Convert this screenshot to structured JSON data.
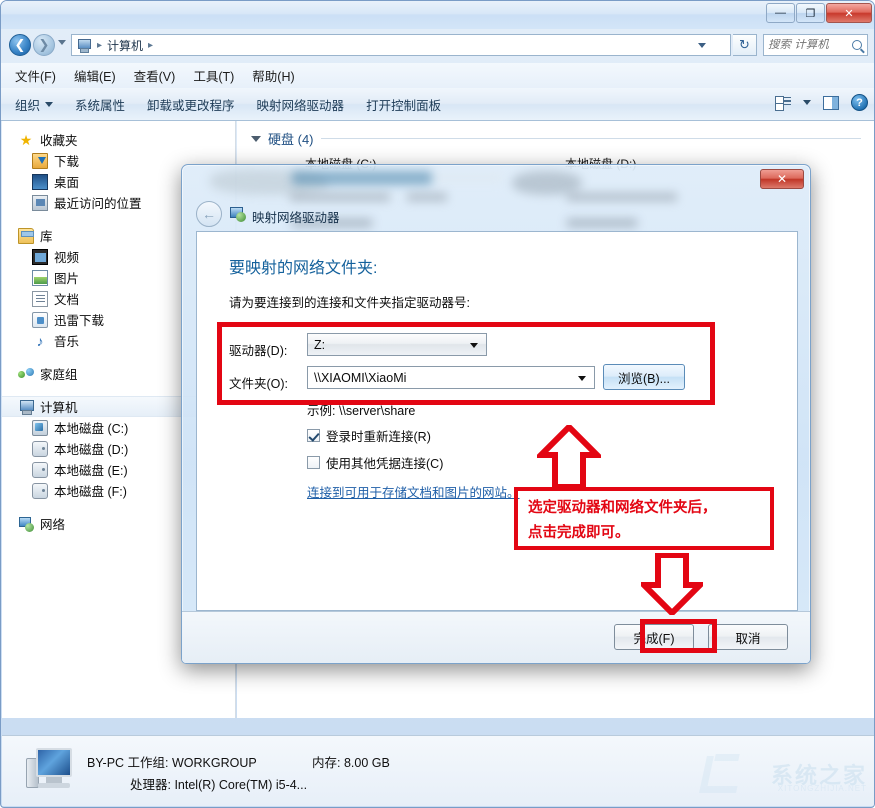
{
  "window": {
    "controls": {
      "minimize": "—",
      "maximize": "❐",
      "close": "✕"
    }
  },
  "address": {
    "breadcrumb": [
      "计算机"
    ],
    "separator": "▸",
    "refresh_icon": "↻",
    "dropdown_icon": "chevron-down-icon"
  },
  "search": {
    "placeholder": "搜索 计算机",
    "value": ""
  },
  "menubar": {
    "items": [
      "文件(F)",
      "编辑(E)",
      "查看(V)",
      "工具(T)",
      "帮助(H)"
    ]
  },
  "toolbar": {
    "organize": "组织",
    "items": [
      "系统属性",
      "卸载或更改程序",
      "映射网络驱动器",
      "打开控制面板"
    ],
    "help_glyph": "?"
  },
  "navpane": {
    "groups": [
      {
        "header": {
          "label": "收藏夹",
          "icon": "star-icon"
        },
        "items": [
          {
            "label": "下载",
            "icon": "download-icon"
          },
          {
            "label": "桌面",
            "icon": "desktop-icon"
          },
          {
            "label": "最近访问的位置",
            "icon": "recent-places-icon"
          }
        ]
      },
      {
        "header": {
          "label": "库",
          "icon": "library-icon"
        },
        "items": [
          {
            "label": "视频",
            "icon": "video-icon"
          },
          {
            "label": "图片",
            "icon": "pictures-icon"
          },
          {
            "label": "文档",
            "icon": "documents-icon"
          },
          {
            "label": "迅雷下载",
            "icon": "xunlei-download-icon"
          },
          {
            "label": "音乐",
            "icon": "music-icon"
          }
        ]
      },
      {
        "header": {
          "label": "家庭组",
          "icon": "homegroup-icon"
        },
        "items": []
      },
      {
        "header": {
          "label": "计算机",
          "icon": "computer-icon",
          "selected": true
        },
        "items": [
          {
            "label": "本地磁盘 (C:)",
            "icon": "system-drive-icon"
          },
          {
            "label": "本地磁盘 (D:)",
            "icon": "drive-icon"
          },
          {
            "label": "本地磁盘 (E:)",
            "icon": "drive-icon"
          },
          {
            "label": "本地磁盘 (F:)",
            "icon": "drive-icon"
          }
        ]
      },
      {
        "header": {
          "label": "网络",
          "icon": "network-icon"
        },
        "items": []
      }
    ]
  },
  "content": {
    "section_header": "硬盘 (4)",
    "drives": [
      "本地磁盘 (C:)",
      "本地磁盘 (D:)"
    ]
  },
  "statusbar": {
    "line1": "BY-PC  工作组: WORKGROUP",
    "line2": "处理器: Intel(R) Core(TM) i5-4...",
    "memory": "内存: 8.00 GB"
  },
  "watermark": {
    "text": "系统之家",
    "subtext": "XITONGZHIJIA.NET"
  },
  "dialog": {
    "title": "映射网络驱动器",
    "back_glyph": "←",
    "close_glyph": "✕",
    "heading": "要映射的网络文件夹:",
    "subtitle": "请为要连接到的连接和文件夹指定驱动器号:",
    "drive_label": "驱动器(D):",
    "drive_value": "Z:",
    "folder_label": "文件夹(O):",
    "folder_value": "\\\\XIAOMI\\XiaoMi",
    "browse_button": "浏览(B)...",
    "example": "示例: \\\\server\\share",
    "checkbox_reconnect": "登录时重新连接(R)",
    "checkbox_reconnect_checked": true,
    "checkbox_credentials": "使用其他凭据连接(C)",
    "checkbox_credentials_checked": false,
    "link": "连接到可用于存储文档和图片的网站。",
    "finish_button": "完成(F)",
    "cancel_button": "取消"
  },
  "annotation": {
    "color": "#e30613",
    "line1": "选定驱动器和网络文件夹后，",
    "line2": "点击完成即可。"
  }
}
